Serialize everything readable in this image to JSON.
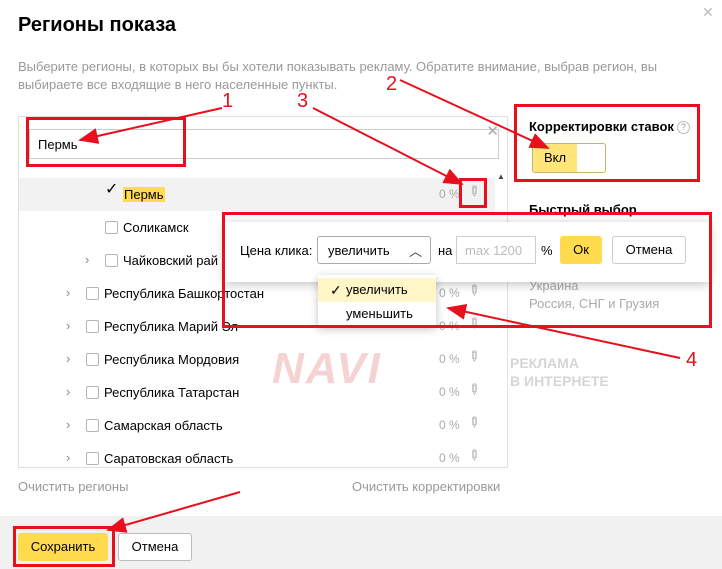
{
  "dialog": {
    "title": "Регионы показа",
    "description": "Выберите регионы, в которых вы бы хотели показывать рекламу. Обратите внимание, выбрав регион, вы выбираете все входящие в него населенные пункты."
  },
  "search": {
    "value": "Пермь"
  },
  "regions": [
    {
      "label": "Пермь",
      "checked": true,
      "pct": "0 %"
    },
    {
      "label": "Соликамск",
      "checked": false,
      "pct": ""
    },
    {
      "label": "Чайковский рай",
      "checked": false,
      "pct": ""
    },
    {
      "label": "Республика Башкортостан",
      "checked": false,
      "pct": "0 %"
    },
    {
      "label": "Республика Марий Эл",
      "checked": false,
      "pct": "0 %"
    },
    {
      "label": "Республика Мордовия",
      "checked": false,
      "pct": "0 %"
    },
    {
      "label": "Республика Татарстан",
      "checked": false,
      "pct": "0 %"
    },
    {
      "label": "Самарская область",
      "checked": false,
      "pct": "0 %"
    },
    {
      "label": "Саратовская область",
      "checked": false,
      "pct": "0 %"
    }
  ],
  "links": {
    "clear_regions": "Очистить регионы",
    "clear_adjustments": "Очистить корректировки"
  },
  "bid_adjust": {
    "title": "Корректировки ставок",
    "help": "?",
    "toggle_label": "Вкл"
  },
  "quick_select": {
    "title": "Быстрый выбор",
    "items": [
      "Украина",
      "Россия, СНГ и Грузия"
    ]
  },
  "popup": {
    "label": "Цена клика:",
    "select_value": "увеличить",
    "on_label": "на",
    "input_placeholder": "max 1200",
    "unit": "%",
    "ok": "Ок",
    "cancel": "Отмена",
    "options": [
      "увеличить",
      "уменьшить"
    ]
  },
  "annotations": [
    "1",
    "2",
    "3",
    "4"
  ],
  "watermark": {
    "big": "NAVI",
    "small_1": "РЕКЛАМА",
    "small_2": "В ИНТЕРНЕТЕ"
  },
  "footer": {
    "save": "Сохранить",
    "cancel": "Отмена"
  },
  "colors": {
    "accent": "#ffdb4d",
    "annotation": "#e8101e"
  },
  "icons": {
    "close": "close-icon",
    "pencil": "pencil-icon",
    "check": "check-icon",
    "chevron": "chevron-right-icon"
  }
}
